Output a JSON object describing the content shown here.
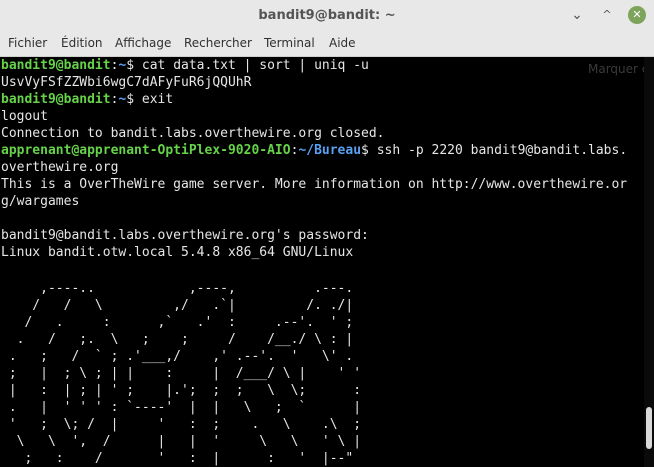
{
  "window": {
    "title": "bandit9@bandit: ~",
    "minimize_symbol": "⌄",
    "maximize_symbol": "^",
    "close_symbol": "✕"
  },
  "menu": [
    {
      "label": "Fichier"
    },
    {
      "label": "Édition"
    },
    {
      "label": "Affichage"
    },
    {
      "label": "Rechercher"
    },
    {
      "label": "Terminal"
    },
    {
      "label": "Aide"
    }
  ],
  "terminal": {
    "ghost_text": "Marquer co",
    "prompt1": {
      "user": "bandit9@bandit",
      "sep": ":",
      "path": "~",
      "cmd": "$ cat data.txt | sort | uniq -u"
    },
    "out1": "UsvVyFSfZZWbi6wgC7dAFyFuR6jQQUhR",
    "prompt2": {
      "user": "bandit9@bandit",
      "sep": ":",
      "path": "~",
      "cmd": "$ exit"
    },
    "out2": "logout",
    "out3": "Connection to bandit.labs.overthewire.org closed.",
    "prompt3": {
      "user": "apprenant@apprenant-OptiPlex-9020-AIO",
      "sep": ":",
      "path": "~/Bureau",
      "cmd": "$ ssh -p 2220 bandit9@bandit.labs."
    },
    "out4": "overthewire.org",
    "out5": "This is a OverTheWire game server. More information on http://www.overthewire.or",
    "out6": "g/wargames",
    "out7": "bandit9@bandit.labs.overthewire.org's password:",
    "out8": "Linux bandit.otw.local 5.4.8 x86_64 GNU/Linux",
    "ascii_art": "     ,----..            ,----,          .---.\n    /   /   \\         ,/   .`|         /. ./|\n   /   .     :      ,`   .'  :     .--'.  ' ;\n  .   /   ;.  \\   ;    ;     /    /__./ \\ : |\n .   ;   /  ` ; .'___,/    ,' .--'.  '   \\' .\n ;   |  ; \\ ; | |    :     |  /___/ \\ |    ' '\n |   :  | ; | ' ;    |.';  ;  ;   \\  \\;      :\n .   |  ' ' ' : `----'  |  |   \\   ;  `      |\n '   ;  \\; /  |     '   :  ;    .   \\    .\\  ;\n  \\   \\  ',  /      |   |  '     \\   \\   ' \\ |\n   ;   :    /       '   :  |      :   '  |--\""
  }
}
